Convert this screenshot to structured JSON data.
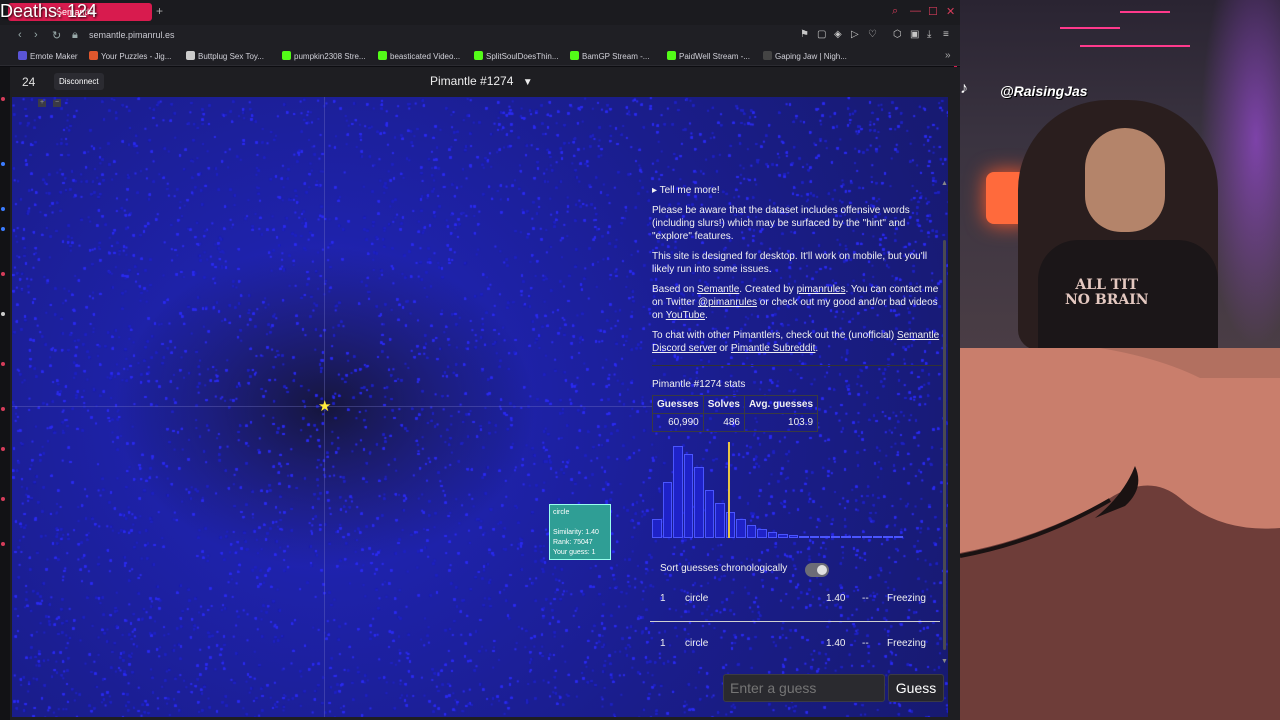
{
  "overlay": {
    "deaths": "Deaths: 124",
    "tiktok_handle": "@RaisingJas"
  },
  "browser": {
    "tab_label": "Semantle",
    "url": "semantle.pimanrul.es",
    "bookmarks": [
      {
        "label": "Emote Maker",
        "color": "#5a54d6"
      },
      {
        "label": "Your Puzzles - Jig...",
        "color": "#e0572d"
      },
      {
        "label": "Buttplug Sex Toy...",
        "color": "#cccccc"
      },
      {
        "label": "pumpkin2308 Stre...",
        "color": "#53fc18"
      },
      {
        "label": "beasticated Video...",
        "color": "#53fc18"
      },
      {
        "label": "SplitSoulDoesThin...",
        "color": "#53fc18"
      },
      {
        "label": "BamGP Stream -...",
        "color": "#53fc18"
      },
      {
        "label": "PaidWell Stream -...",
        "color": "#53fc18"
      },
      {
        "label": "Gaping Jaw | Nigh...",
        "color": "#444444"
      }
    ]
  },
  "header": {
    "guess_count": "24",
    "disconnect_label": "Disconnect",
    "title": "Pimantle #1274",
    "title_caret": "▼"
  },
  "tooltip": {
    "word": "circle",
    "similarity": "Similarity: 1.40",
    "rank": "Rank: 75047",
    "your_guess": "Your guess: 1"
  },
  "panel": {
    "tell_more": "▸ Tell me more!",
    "warning": "Please be aware that the dataset includes offensive words (including slurs!) which may be surfaced by the \"hint\" and \"explore\" features.",
    "desktop_note": "This site is designed for desktop. It'll work on mobile, but you'll likely run into some issues.",
    "credits_pre": "Based on ",
    "credits_semantle": "Semantle",
    "credits_mid": ". Created by ",
    "credits_author": "pimanrules",
    "credits_mid2": ". You can contact me on Twitter ",
    "credits_twitter": "@pimanrules",
    "credits_mid3": " or check out my good and/or bad videos on ",
    "credits_youtube": "YouTube",
    "credits_end": ".",
    "chat_pre": "To chat with other Pimantlers, check out the (unofficial) ",
    "chat_discord": "Semantle Discord server",
    "chat_mid": " or ",
    "chat_reddit": "Pimantle Subreddit",
    "chat_end": ".",
    "stats_title": "Pimantle #1274 stats",
    "stats_headers": [
      "Guesses",
      "Solves",
      "Avg. guesses"
    ],
    "stats_values": [
      "60,990",
      "486",
      "103.9"
    ],
    "sort_label": "Sort guesses chronologically"
  },
  "histogram": {
    "values": [
      18,
      52,
      85,
      78,
      66,
      44,
      32,
      24,
      18,
      12,
      8,
      6,
      4,
      3,
      2,
      2,
      1,
      1,
      1,
      1,
      1,
      1,
      1,
      0
    ],
    "avg_marker_index": 7.2
  },
  "guesses": [
    {
      "num": "1",
      "word": "circle",
      "similarity": "1.40",
      "rank": "--",
      "temp": "Freezing"
    },
    {
      "num": "1",
      "word": "circle",
      "similarity": "1.40",
      "rank": "--",
      "temp": "Freezing"
    }
  ],
  "input": {
    "placeholder": "Enter a guess",
    "button": "Guess"
  },
  "shirt_text": "ALL TIT\nNO BRAIN"
}
